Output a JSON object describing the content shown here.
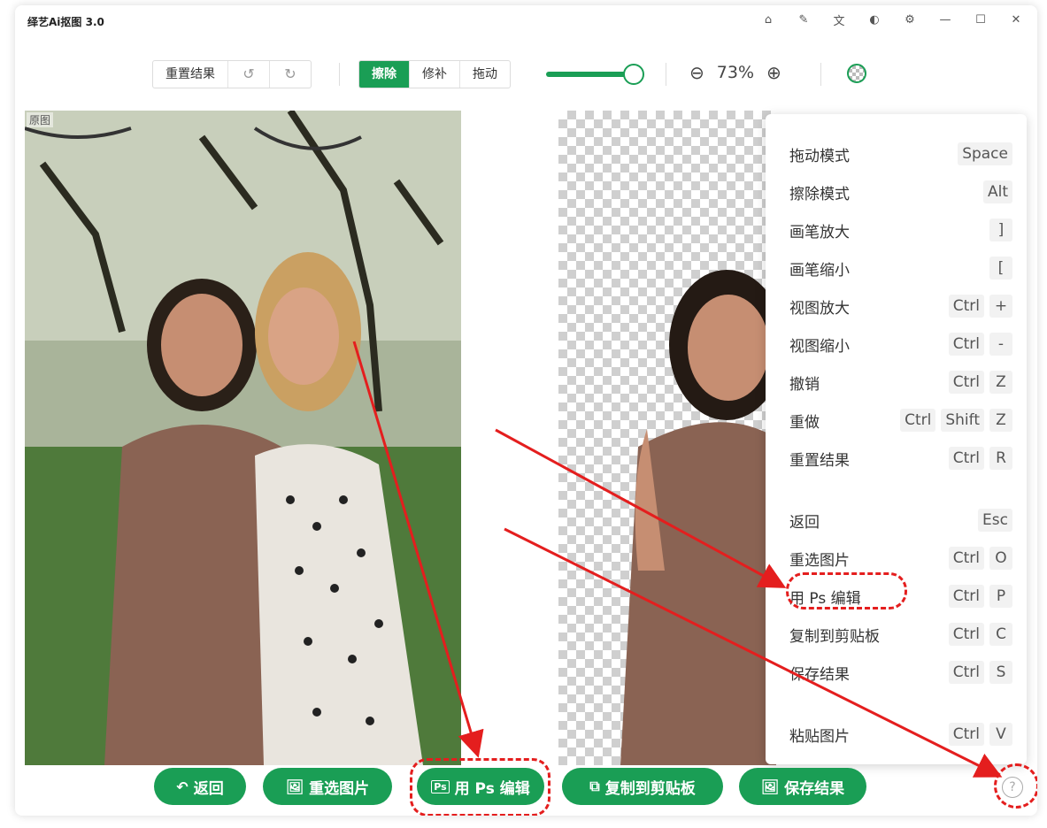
{
  "app": {
    "title": "Ai抠图 3.0",
    "title_prefix": "绎艺"
  },
  "window_controls": [
    "home-icon",
    "skin-icon",
    "translate-icon",
    "theme-icon",
    "settings-icon",
    "minimize-icon",
    "maximize-icon",
    "close-icon"
  ],
  "toolbar": {
    "reset_label": "重置结果",
    "undo_icon": "undo-icon",
    "redo_icon": "redo-icon",
    "modes": [
      {
        "label": "擦除",
        "active": true
      },
      {
        "label": "修补",
        "active": false
      },
      {
        "label": "拖动",
        "active": false
      }
    ],
    "brush_size_fraction": 0.85,
    "zoom_label": "73%",
    "zoom_out_icon": "zoom-out-icon",
    "zoom_in_icon": "zoom-in-icon",
    "background_icon": "checkerboard-icon"
  },
  "panels": {
    "original_label": "原图"
  },
  "shortcuts": [
    {
      "label": "拖动模式",
      "keys": [
        "Space"
      ]
    },
    {
      "label": "擦除模式",
      "keys": [
        "Alt"
      ]
    },
    {
      "label": "画笔放大",
      "keys": [
        "]"
      ]
    },
    {
      "label": "画笔缩小",
      "keys": [
        "["
      ]
    },
    {
      "label": "视图放大",
      "keys": [
        "Ctrl",
        "+"
      ]
    },
    {
      "label": "视图缩小",
      "keys": [
        "Ctrl",
        "-"
      ]
    },
    {
      "label": "撤销",
      "keys": [
        "Ctrl",
        "Z"
      ]
    },
    {
      "label": "重做",
      "keys": [
        "Ctrl",
        "Shift",
        "Z"
      ]
    },
    {
      "label": "重置结果",
      "keys": [
        "Ctrl",
        "R"
      ]
    },
    {
      "label": "返回",
      "keys": [
        "Esc"
      ]
    },
    {
      "label": "重选图片",
      "keys": [
        "Ctrl",
        "O"
      ]
    },
    {
      "label": "用 Ps 编辑",
      "keys": [
        "Ctrl",
        "P"
      ]
    },
    {
      "label": "复制到剪贴板",
      "keys": [
        "Ctrl",
        "C"
      ]
    },
    {
      "label": "保存结果",
      "keys": [
        "Ctrl",
        "S"
      ]
    },
    {
      "label": "粘贴图片",
      "keys": [
        "Ctrl",
        "V"
      ]
    }
  ],
  "bottom_bar": {
    "back": "返回",
    "reselect": "重选图片",
    "edit_ps": "用 Ps 编辑",
    "copy": "复制到剪贴板",
    "save": "保存结果",
    "help_icon": "help-icon"
  },
  "colors": {
    "accent": "#1a9e55",
    "annotation": "#e41e1e"
  }
}
